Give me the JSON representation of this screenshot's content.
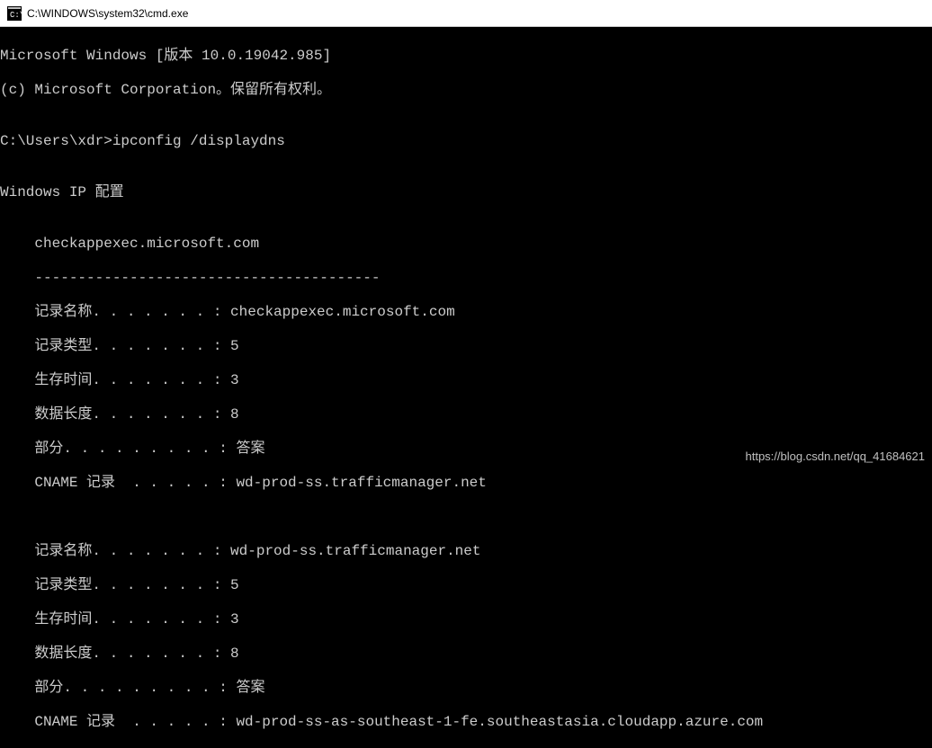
{
  "titlebar": {
    "path": "C:\\WINDOWS\\system32\\cmd.exe"
  },
  "terminal": {
    "line1": "Microsoft Windows [版本 10.0.19042.985]",
    "line2": "(c) Microsoft Corporation。保留所有权利。",
    "blank1": "",
    "prompt_line": "C:\\Users\\xdr>ipconfig /displaydns",
    "blank2": "",
    "header": "Windows IP 配置",
    "blank3": "",
    "section1": {
      "title": "    checkappexec.microsoft.com",
      "divider": "    ----------------------------------------",
      "rows": [
        "    记录名称. . . . . . . : checkappexec.microsoft.com",
        "    记录类型. . . . . . . : 5",
        "    生存时间. . . . . . . : 3",
        "    数据长度. . . . . . . : 8",
        "    部分. . . . . . . . . : 答案",
        "    CNAME 记录  . . . . . : wd-prod-ss.trafficmanager.net"
      ]
    },
    "blank4": "",
    "blank5": "",
    "section2": {
      "rows": [
        "    记录名称. . . . . . . : wd-prod-ss.trafficmanager.net",
        "    记录类型. . . . . . . : 5",
        "    生存时间. . . . . . . : 3",
        "    数据长度. . . . . . . : 8",
        "    部分. . . . . . . . . : 答案",
        "    CNAME 记录  . . . . . : wd-prod-ss-as-southeast-1-fe.southeastasia.cloudapp.azure.com"
      ]
    }
  },
  "watermark": "https://blog.csdn.net/qq_41684621"
}
